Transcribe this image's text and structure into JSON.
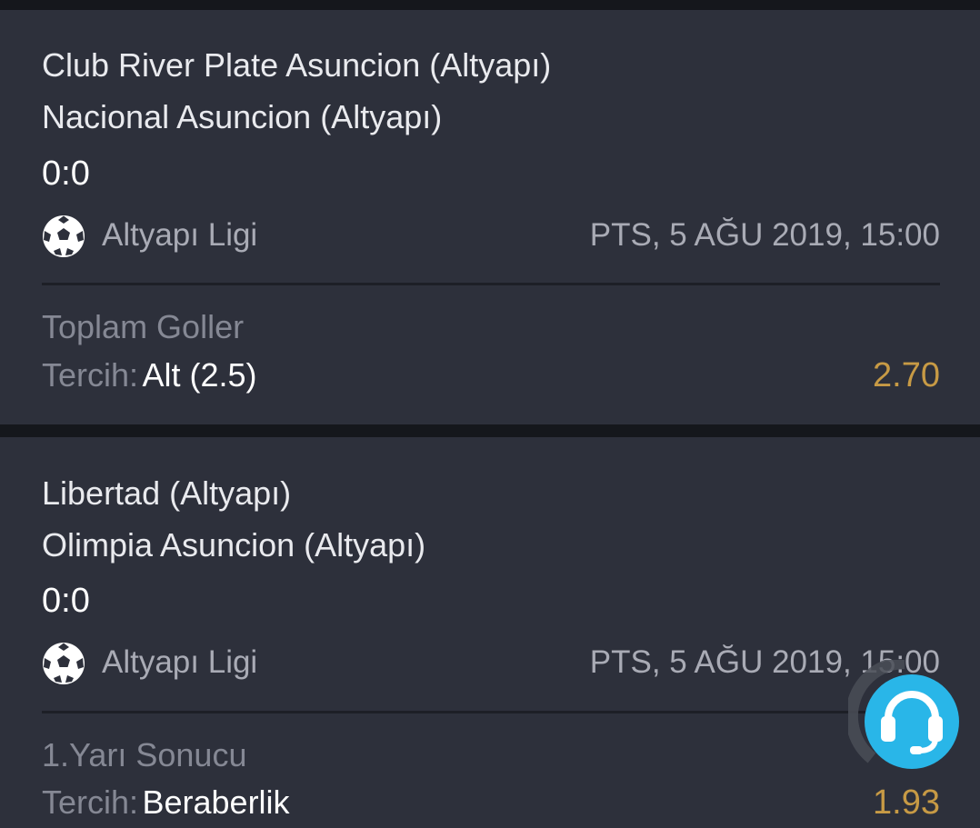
{
  "bets": [
    {
      "home_team": "Club River Plate Asuncion (Altyapı)",
      "away_team": "Nacional Asuncion (Altyapı)",
      "score": "0:0",
      "sport_icon": "soccer-ball-icon",
      "league": "Altyapı Ligi",
      "datetime": "PTS, 5 AĞU 2019, 15:00",
      "market": "Toplam Goller",
      "choice_label": "Tercih:",
      "choice_value": "Alt (2.5)",
      "odds": "2.70"
    },
    {
      "home_team": "Libertad (Altyapı)",
      "away_team": "Olimpia Asuncion (Altyapı)",
      "score": "0:0",
      "sport_icon": "soccer-ball-icon",
      "league": "Altyapı Ligi",
      "datetime": "PTS, 5 AĞU 2019, 15:00",
      "market": "1.Yarı Sonucu",
      "choice_label": "Tercih:",
      "choice_value": "Beraberlik",
      "odds": "1.93"
    }
  ],
  "support_button": {
    "icon": "headset-icon"
  },
  "colors": {
    "background": "#15171c",
    "card": "#2d303b",
    "odds": "#c79a45",
    "support": "#29b6e8"
  }
}
